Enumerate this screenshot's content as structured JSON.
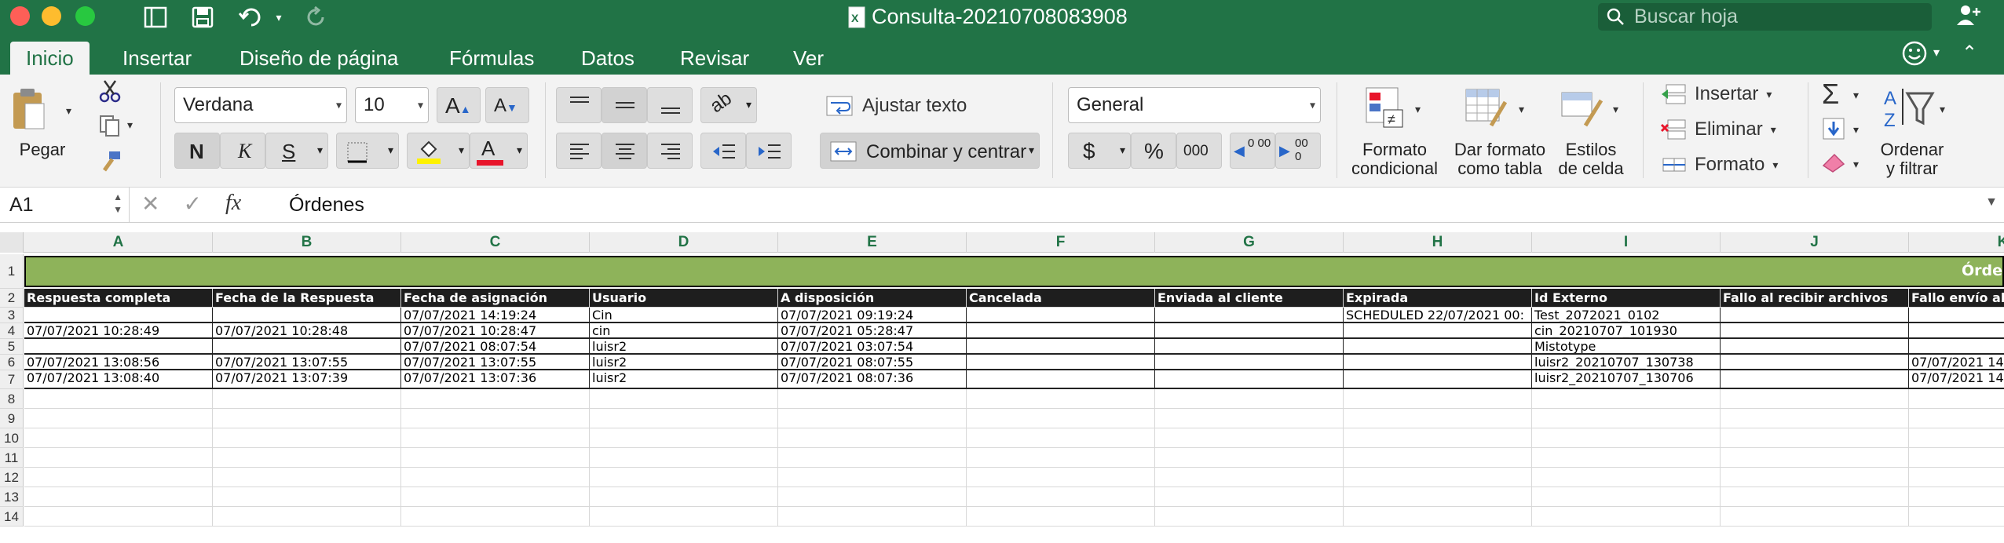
{
  "window": {
    "title": "Consulta-20210708083908",
    "search_placeholder": "Buscar hoja"
  },
  "tabs": [
    "Inicio",
    "Insertar",
    "Diseño de página",
    "Fórmulas",
    "Datos",
    "Revisar",
    "Ver"
  ],
  "ribbon": {
    "paste_label": "Pegar",
    "font_name": "Verdana",
    "font_size": "10",
    "bold": "N",
    "italic": "K",
    "underline": "S",
    "wrap_text": "Ajustar texto",
    "merge_center": "Combinar y centrar",
    "number_format": "General",
    "currency": "$",
    "percent": "%",
    "thousands": "000",
    "dec_increase": "0 00",
    "dec_decrease": "00 0",
    "conditional_format": [
      "Formato",
      "condicional"
    ],
    "format_table": [
      "Dar formato",
      "como tabla"
    ],
    "cell_styles": [
      "Estilos",
      "de celda"
    ],
    "insert": "Insertar",
    "delete": "Eliminar",
    "format": "Formato",
    "sort_filter": [
      "Ordenar",
      "y filtrar"
    ]
  },
  "formula_bar": {
    "cell_ref": "A1",
    "content": "Órdenes"
  },
  "sheet": {
    "columns": [
      "A",
      "B",
      "C",
      "D",
      "E",
      "F",
      "G",
      "H",
      "I",
      "J",
      "K"
    ],
    "row_numbers": [
      "1",
      "2",
      "3",
      "4",
      "5",
      "6",
      "7",
      "8",
      "9",
      "10",
      "11",
      "12",
      "13",
      "14"
    ],
    "banner": "Órde",
    "headers": [
      "Respuesta completa",
      "Fecha de la Respuesta",
      "Fecha de asignación",
      "Usuario",
      "A disposición",
      "Cancelada",
      "Enviada al cliente",
      "Expirada",
      "Id Externo",
      "Fallo al recibir archivos",
      "Fallo envío al"
    ],
    "rows": [
      [
        "",
        "",
        "07/07/2021 14:19:24",
        "Cin",
        "07/07/2021 09:19:24",
        "",
        "",
        "SCHEDULED 22/07/2021 00:",
        "Test_2072021_0102",
        "",
        ""
      ],
      [
        "07/07/2021 10:28:49",
        "07/07/2021 10:28:48",
        "07/07/2021 10:28:47",
        "cin",
        "07/07/2021 05:28:47",
        "",
        "",
        "",
        "cin_20210707_101930",
        "",
        ""
      ],
      [
        "",
        "",
        "07/07/2021 08:07:54",
        "luisr2",
        "07/07/2021 03:07:54",
        "",
        "",
        "",
        "Mistotype",
        "",
        ""
      ],
      [
        "07/07/2021 13:08:56",
        "07/07/2021 13:07:55",
        "07/07/2021 13:07:55",
        "luisr2",
        "07/07/2021 08:07:55",
        "",
        "",
        "",
        "luisr2_20210707_130738",
        "",
        "07/07/2021 14"
      ],
      [
        "07/07/2021 13:08:40",
        "07/07/2021 13:07:39",
        "07/07/2021 13:07:36",
        "luisr2",
        "07/07/2021 08:07:36",
        "",
        "",
        "",
        "luisr2_20210707_130706",
        "",
        "07/07/2021 14"
      ]
    ]
  },
  "colors": {
    "excel_green": "#217346",
    "banner_green": "#8eb35a",
    "header_black": "#1e1e1e"
  }
}
